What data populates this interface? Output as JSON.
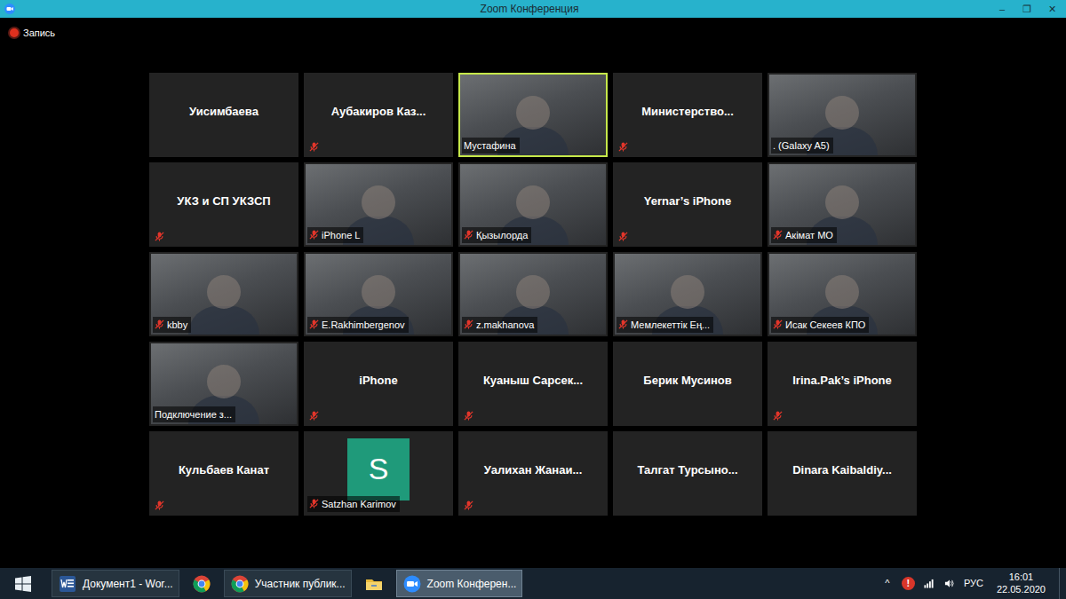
{
  "window": {
    "title": "Zoom Конференция",
    "controls": [
      "–",
      "❐",
      "✕"
    ]
  },
  "recording": {
    "label": "Запись"
  },
  "participants": [
    {
      "name": "Уисимбаева",
      "kind": "name",
      "muted": false,
      "speaking": false
    },
    {
      "name": "Аубакиров  Каз...",
      "kind": "name",
      "muted": true,
      "speaking": false
    },
    {
      "name": "Мустафина",
      "kind": "video",
      "muted": false,
      "speaking": true
    },
    {
      "name": "Министерство...",
      "kind": "name",
      "muted": true,
      "speaking": false
    },
    {
      "name": ". (Galaxy A5)",
      "kind": "video",
      "muted": false,
      "speaking": false
    },
    {
      "name": "УКЗ и СП УКЗСП",
      "kind": "name",
      "muted": true,
      "speaking": false
    },
    {
      "name": "iPhone L",
      "kind": "video",
      "muted": true,
      "speaking": false
    },
    {
      "name": "Қызылорда",
      "kind": "video",
      "muted": true,
      "speaking": false
    },
    {
      "name": "Yernar’s iPhone",
      "kind": "name",
      "muted": true,
      "speaking": false
    },
    {
      "name": "Акімат МО",
      "kind": "video",
      "muted": true,
      "speaking": false
    },
    {
      "name": "kbby",
      "kind": "video",
      "muted": true,
      "speaking": false
    },
    {
      "name": "E.Rakhimbergenov",
      "kind": "video",
      "muted": true,
      "speaking": false
    },
    {
      "name": "z.makhanova",
      "kind": "video",
      "muted": true,
      "speaking": false
    },
    {
      "name": "Мемлекеттік Ең...",
      "kind": "video",
      "muted": true,
      "speaking": false
    },
    {
      "name": "Исак Секеев КПО",
      "kind": "video",
      "muted": true,
      "speaking": false
    },
    {
      "name": "Подключение з...",
      "kind": "video",
      "muted": false,
      "speaking": false
    },
    {
      "name": "iPhone",
      "kind": "name",
      "muted": true,
      "speaking": false
    },
    {
      "name": "Куаныш  Сарсек...",
      "kind": "name",
      "muted": true,
      "speaking": false
    },
    {
      "name": "Берик Мусинов",
      "kind": "name",
      "muted": false,
      "speaking": false
    },
    {
      "name": "Irina.Pak’s iPhone",
      "kind": "name",
      "muted": true,
      "speaking": false
    },
    {
      "name": "Кульбаев Канат",
      "kind": "name",
      "muted": true,
      "speaking": false
    },
    {
      "name": "Satzhan Karimov",
      "kind": "avatar",
      "avatar": "S",
      "muted": true,
      "speaking": false
    },
    {
      "name": "Уалихан  Жанаи...",
      "kind": "name",
      "muted": true,
      "speaking": false
    },
    {
      "name": "Талгат  Турсыно...",
      "kind": "name",
      "muted": false,
      "speaking": false
    },
    {
      "name": "Dinara  Kaibaldiy...",
      "kind": "name",
      "muted": false,
      "speaking": false
    }
  ],
  "taskbar": {
    "items": [
      {
        "kind": "word",
        "label": "Документ1 - Wor...",
        "selected": false
      },
      {
        "kind": "chrome",
        "selected": false
      },
      {
        "kind": "chrome",
        "label": "Участник публик...",
        "selected": false
      },
      {
        "kind": "explorer",
        "selected": false
      },
      {
        "kind": "zoom",
        "label": "Zoom Конферен...",
        "selected": true
      }
    ],
    "tray": [
      {
        "kind": "chevron",
        "label": "^"
      },
      {
        "kind": "alert",
        "label": "!"
      },
      {
        "kind": "network"
      },
      {
        "kind": "volume"
      },
      {
        "kind": "language",
        "label": "РУС"
      }
    ],
    "time": "16:01",
    "date": "22.05.2020"
  }
}
